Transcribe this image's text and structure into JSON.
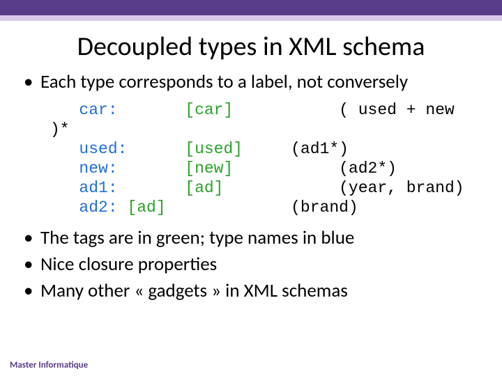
{
  "title": "Decoupled types in XML schema",
  "bullets": [
    "Each type corresponds to a label, not conversely",
    "The tags are in green; type names in blue",
    "Nice closure properties",
    "Many other « gadgets » in XML schemas"
  ],
  "code": {
    "l1_t": "car:",
    "l1_tag": "[car]",
    "l1_r": "( used + new",
    "l2": ")*",
    "l3_t": "used:",
    "l3_tag": "[used]",
    "l3_r": "(ad1*)",
    "l4_t": "new:",
    "l4_tag": "[new]",
    "l4_r": "(ad2*)",
    "l5_t": "ad1:",
    "l5_tag": "[ad]",
    "l5_r": "(year, brand)",
    "l6_t": "ad2:",
    "l6_tag": "[ad]",
    "l6_r": "(brand)"
  },
  "footer": {
    "left": "Master Informatique"
  }
}
